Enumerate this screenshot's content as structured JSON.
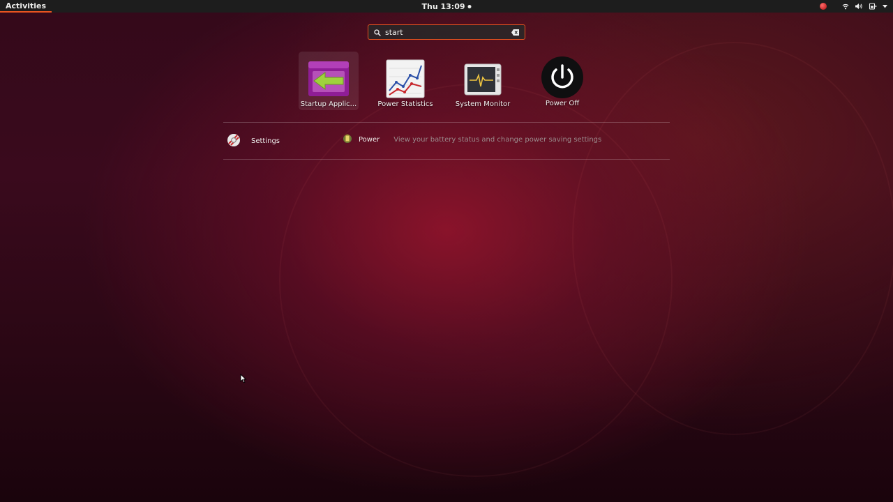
{
  "topbar": {
    "activities": "Activities",
    "clock": "Thu 13:09"
  },
  "tray": {
    "icons": [
      "record-icon",
      "network-icon",
      "volume-icon",
      "power-icon",
      "chevron-down-icon"
    ]
  },
  "search": {
    "value": "start",
    "icon": "search-icon",
    "clear_icon": "clear-icon"
  },
  "apps": [
    {
      "label": "Startup Applic...",
      "icon": "startup-applications-icon",
      "selected": true
    },
    {
      "label": "Power Statistics",
      "icon": "power-statistics-icon",
      "selected": false
    },
    {
      "label": "System Monitor",
      "icon": "system-monitor-icon",
      "selected": false
    },
    {
      "label": "Power Off",
      "icon": "power-off-icon",
      "selected": false
    }
  ],
  "providers": [
    {
      "name": "Settings",
      "icon": "settings-icon",
      "results": [
        {
          "title": "Power",
          "description": "View your battery status and change power saving settings",
          "icon": "power-battery-icon"
        }
      ]
    }
  ],
  "colors": {
    "accent": "#e95420",
    "topbar": "#1d1d1d",
    "background": "#3a0a1d"
  }
}
